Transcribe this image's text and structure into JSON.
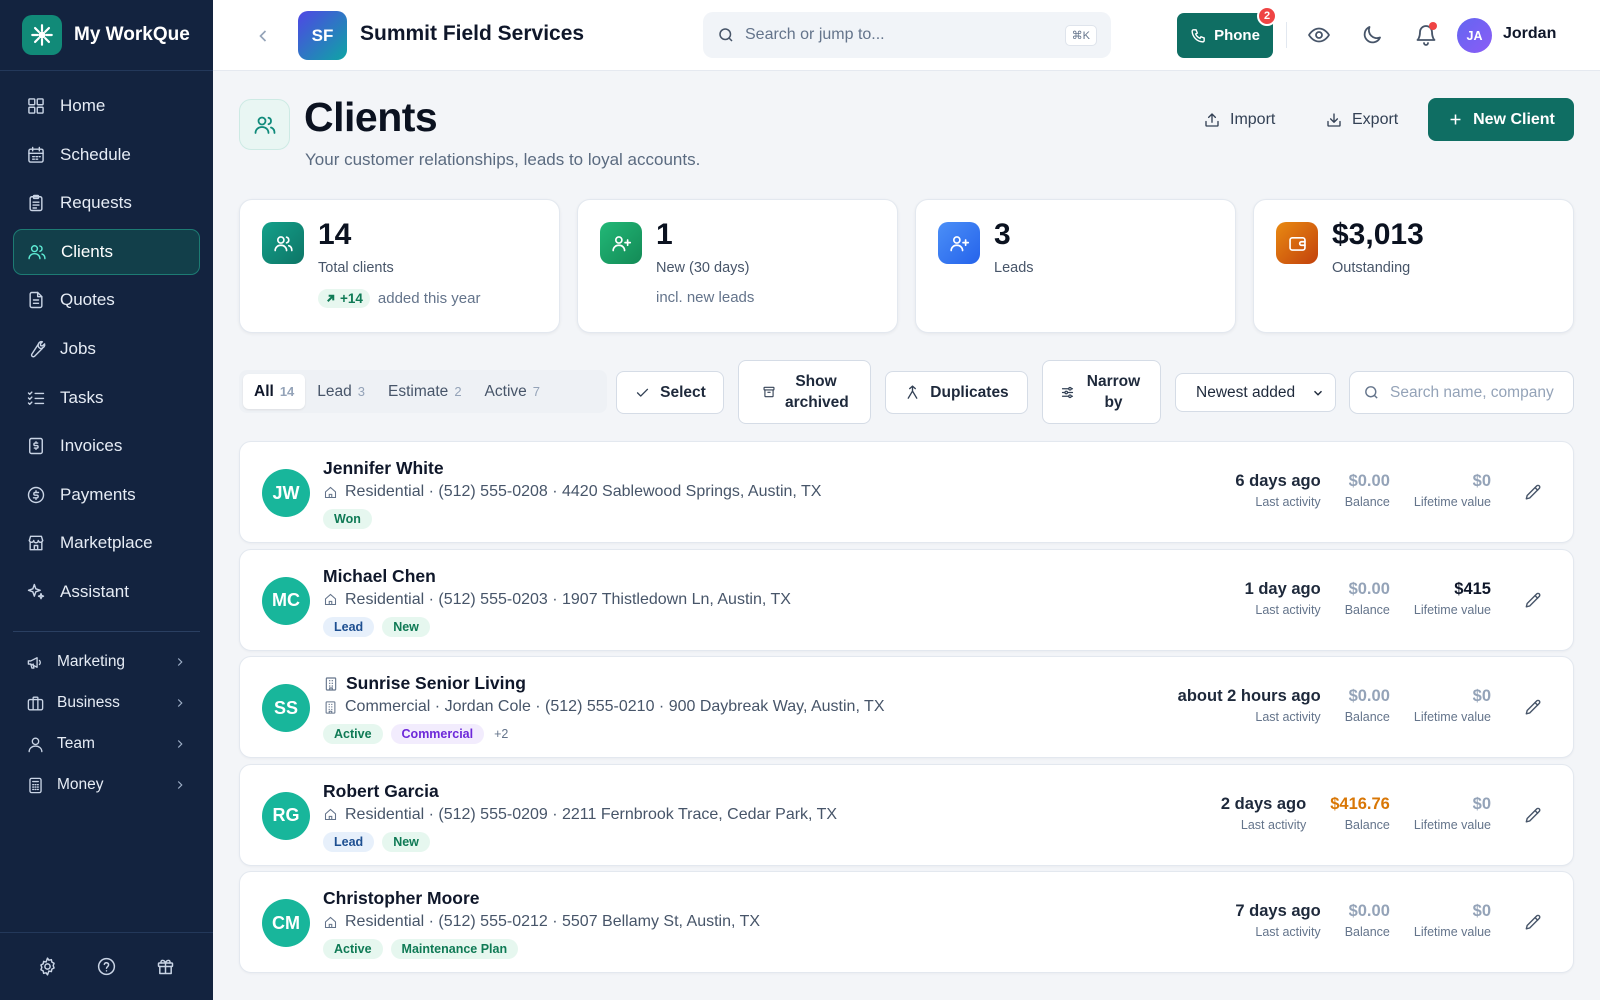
{
  "brand": {
    "name": "My WorkQue",
    "icon": "asterisk-logo-icon"
  },
  "sidebar": {
    "items": [
      {
        "label": "Home",
        "icon": "grid-icon"
      },
      {
        "label": "Schedule",
        "icon": "calendar-icon"
      },
      {
        "label": "Requests",
        "icon": "clipboard-icon"
      },
      {
        "label": "Clients",
        "icon": "users-icon",
        "active": true
      },
      {
        "label": "Quotes",
        "icon": "document-icon"
      },
      {
        "label": "Jobs",
        "icon": "wrench-icon"
      },
      {
        "label": "Tasks",
        "icon": "checklist-icon"
      },
      {
        "label": "Invoices",
        "icon": "invoice-icon"
      },
      {
        "label": "Payments",
        "icon": "dollar-circle-icon"
      },
      {
        "label": "Marketplace",
        "icon": "store-icon"
      },
      {
        "label": "Assistant",
        "icon": "sparkle-icon"
      }
    ],
    "groups": [
      {
        "label": "Marketing",
        "icon": "megaphone-icon"
      },
      {
        "label": "Business",
        "icon": "briefcase-icon"
      },
      {
        "label": "Team",
        "icon": "user-icon"
      },
      {
        "label": "Money",
        "icon": "calculator-icon"
      }
    ]
  },
  "topbar": {
    "org_initials": "SF",
    "org_name": "Summit Field Services",
    "search_placeholder": "Search or jump to...",
    "search_shortcut": "⌘K",
    "phone_label": "Phone",
    "phone_badge": "2",
    "user_initials": "JA",
    "user_name": "Jordan"
  },
  "page": {
    "title": "Clients",
    "subtitle": "Your customer relationships, leads to loyal accounts.",
    "import_label": "Import",
    "export_label": "Export",
    "new_client_label": "New Client"
  },
  "stats": [
    {
      "value": "14",
      "label": "Total clients",
      "trend": "+14",
      "extra": "added this year",
      "color": "#0f8f7d"
    },
    {
      "value": "1",
      "label": "New (30 days)",
      "extra": "incl. new leads",
      "color": "#16a36a"
    },
    {
      "value": "3",
      "label": "Leads",
      "color": "#3b82f6"
    },
    {
      "value": "$3,013",
      "label": "Outstanding",
      "color": "#d97706"
    }
  ],
  "filters": {
    "tabs": [
      {
        "label": "All",
        "count": "14",
        "active": true
      },
      {
        "label": "Lead",
        "count": "3"
      },
      {
        "label": "Estimate",
        "count": "2"
      },
      {
        "label": "Active",
        "count": "7"
      }
    ],
    "select_label": "Select",
    "show_archived_label": "Show archived",
    "duplicates_label": "Duplicates",
    "narrow_by_label": "Narrow by",
    "sort_value": "Newest added",
    "search_placeholder": "Search name, company"
  },
  "clients": [
    {
      "initials": "JW",
      "name": "Jennifer White",
      "company": false,
      "meta": "Residential · (512) 555-0208 · 4420 Sablewood Springs, Austin, TX",
      "tags": [
        {
          "label": "Won",
          "kind": "won"
        }
      ],
      "last_activity": "6 days ago",
      "balance": "$0.00",
      "balance_style": "muted",
      "lifetime": "$0",
      "lifetime_style": "muted"
    },
    {
      "initials": "MC",
      "name": "Michael Chen",
      "company": false,
      "meta": "Residential · (512) 555-0203 · 1907 Thistledown Ln, Austin, TX",
      "tags": [
        {
          "label": "Lead",
          "kind": "lead"
        },
        {
          "label": "New",
          "kind": "new"
        }
      ],
      "last_activity": "1 day ago",
      "balance": "$0.00",
      "balance_style": "muted",
      "lifetime": "$415",
      "lifetime_style": "strong"
    },
    {
      "initials": "SS",
      "name": "Sunrise Senior Living",
      "company": true,
      "meta": "Commercial · Jordan Cole · (512) 555-0210 · 900 Daybreak Way, Austin, TX",
      "tags": [
        {
          "label": "Active",
          "kind": "active"
        },
        {
          "label": "Commercial",
          "kind": "commercial"
        },
        {
          "label": "+2",
          "kind": "more"
        }
      ],
      "last_activity": "about 2 hours ago",
      "balance": "$0.00",
      "balance_style": "muted",
      "lifetime": "$0",
      "lifetime_style": "muted"
    },
    {
      "initials": "RG",
      "name": "Robert Garcia",
      "company": false,
      "meta": "Residential · (512) 555-0209 · 2211 Fernbrook Trace, Cedar Park, TX",
      "tags": [
        {
          "label": "Lead",
          "kind": "lead"
        },
        {
          "label": "New",
          "kind": "new"
        }
      ],
      "last_activity": "2 days ago",
      "balance": "$416.76",
      "balance_style": "orange",
      "lifetime": "$0",
      "lifetime_style": "muted"
    },
    {
      "initials": "CM",
      "name": "Christopher Moore",
      "company": false,
      "meta": "Residential · (512) 555-0212 · 5507 Bellamy St, Austin, TX",
      "tags": [
        {
          "label": "Active",
          "kind": "active"
        },
        {
          "label": "Maintenance Plan",
          "kind": "maint"
        }
      ],
      "last_activity": "7 days ago",
      "balance": "$0.00",
      "balance_style": "muted",
      "lifetime": "$0",
      "lifetime_style": "muted"
    }
  ],
  "labels": {
    "last_activity": "Last activity",
    "balance": "Balance",
    "lifetime": "Lifetime value"
  }
}
